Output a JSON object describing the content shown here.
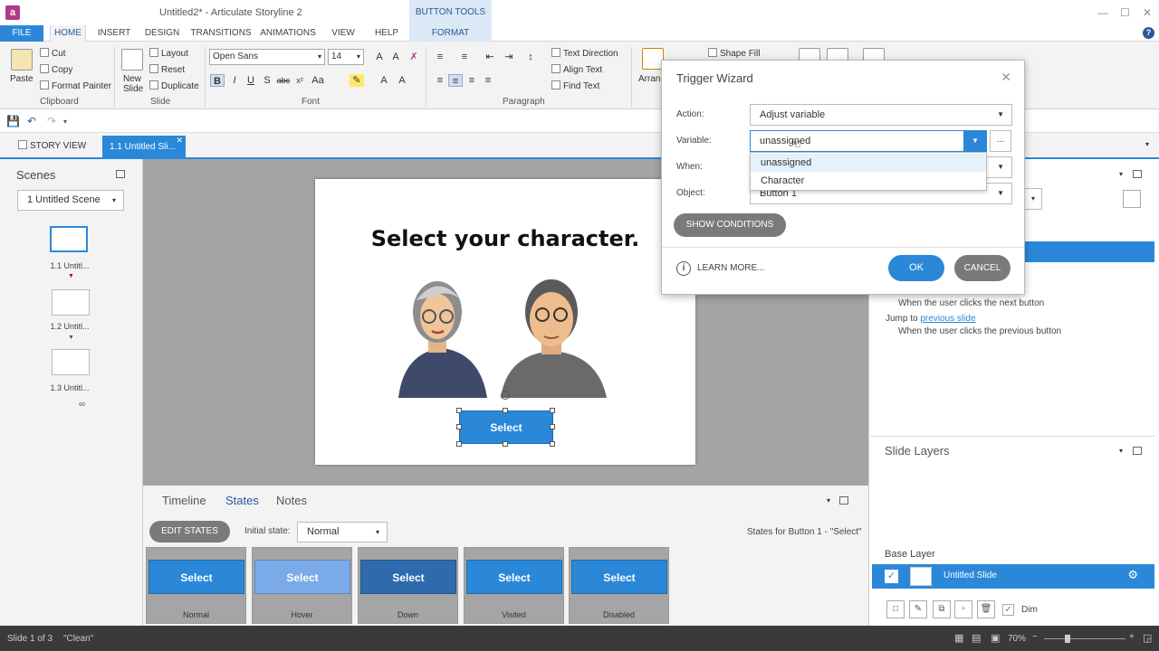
{
  "window": {
    "title": "Untitled2* - Articulate Storyline 2",
    "app_logo": "a"
  },
  "context_tab": {
    "header": "BUTTON TOOLS"
  },
  "menu": {
    "file": "FILE",
    "home": "HOME",
    "insert": "INSERT",
    "design": "DESIGN",
    "transitions": "TRANSITIONS",
    "animations": "ANIMATIONS",
    "view": "VIEW",
    "help": "HELP",
    "format": "FORMAT"
  },
  "ribbon": {
    "clipboard": {
      "label": "Clipboard",
      "paste": "Paste",
      "cut": "Cut",
      "copy": "Copy",
      "format_painter": "Format Painter"
    },
    "slide": {
      "label": "Slide",
      "new_slide": "New Slide",
      "layout": "Layout",
      "reset": "Reset",
      "duplicate": "Duplicate"
    },
    "font": {
      "label": "Font",
      "family": "Open Sans",
      "size": "14"
    },
    "paragraph": {
      "label": "Paragraph",
      "text_direction": "Text Direction",
      "align_text": "Align Text",
      "find_text": "Find Text"
    },
    "drawing": {
      "arrange": "Arran",
      "shape_fill": "Shape Fill"
    }
  },
  "view_tabs": {
    "story_view": "STORY VIEW",
    "slide_tab": "1.1 Untitled Sli..."
  },
  "scenes": {
    "title": "Scenes",
    "dropdown": "1 Untitled Scene",
    "slides": [
      {
        "label": "1.1 Untitl..."
      },
      {
        "label": "1.2 Untitl..."
      },
      {
        "label": "1.3 Untitl..."
      }
    ]
  },
  "slide": {
    "heading": "Select your character.",
    "button_label": "Select"
  },
  "bottom": {
    "tabs": {
      "timeline": "Timeline",
      "states": "States",
      "notes": "Notes"
    },
    "edit_states": "EDIT STATES",
    "initial_label": "Initial state:",
    "initial_value": "Normal",
    "states_for": "States for Button 1 - \"Select\"",
    "states": [
      {
        "button": "Select",
        "name": "Normal",
        "color": "#2b88d8"
      },
      {
        "button": "Select",
        "name": "Hover",
        "color": "#7aaae8"
      },
      {
        "button": "Select",
        "name": "Down",
        "color": "#2f6aad"
      },
      {
        "button": "Select",
        "name": "Visited",
        "color": "#2b88d8"
      },
      {
        "button": "Select",
        "name": "Disabled",
        "color": "#2b88d8"
      }
    ]
  },
  "triggers": {
    "line1": "When the user clicks the next button",
    "jump_prefix": "Jump to",
    "jump_link": "previous slide",
    "line2": "When the user clicks the previous button"
  },
  "layers": {
    "title": "Slide Layers",
    "base_layer": "Base Layer",
    "layer_name": "Untitled Slide",
    "dim": "Dim"
  },
  "status": {
    "slide": "Slide 1 of 3",
    "clean": "\"Clean\"",
    "zoom": "70%"
  },
  "dialog": {
    "title": "Trigger Wizard",
    "action_label": "Action:",
    "action_value": "Adjust variable",
    "variable_label": "Variable:",
    "variable_value": "unassigned",
    "when_label": "When:",
    "object_label": "Object:",
    "object_value": "Button 1",
    "ellipsis": "...",
    "options": [
      "unassigned",
      "Character"
    ],
    "show_conditions": "SHOW CONDITIONS",
    "learn_more": "LEARN MORE...",
    "ok": "OK",
    "cancel": "CANCEL"
  },
  "colors": {
    "accent": "#2b88d8",
    "status_bar": "#3a3a3a"
  }
}
